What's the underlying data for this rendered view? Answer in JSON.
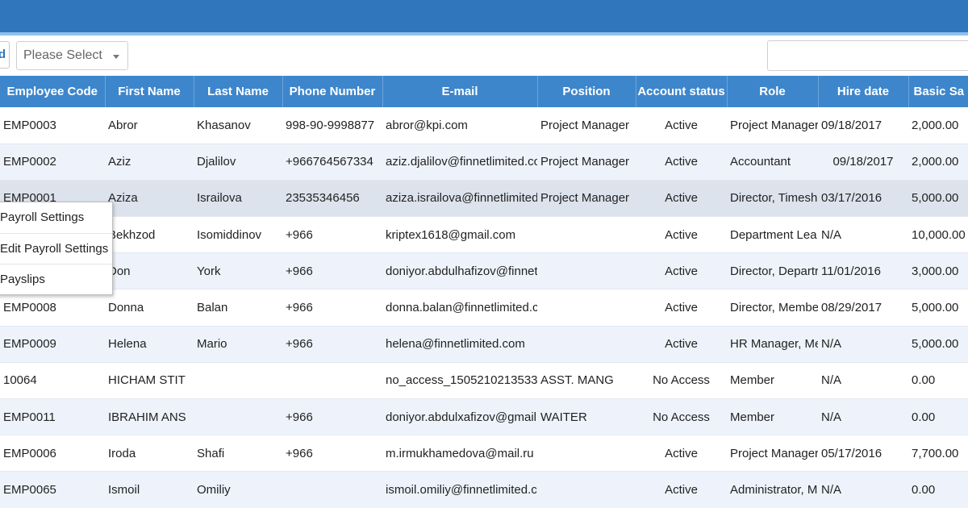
{
  "toolbar": {
    "edge_button_label": "d",
    "select_value": "Please Select",
    "search_placeholder": ""
  },
  "table": {
    "headers": [
      "Employee Code",
      "First Name",
      "Last Name",
      "Phone Number",
      "E-mail",
      "Position",
      "Account status",
      "Role",
      "Hire date",
      "Basic Sa"
    ],
    "rows": [
      [
        "EMP0003",
        "Abror",
        "Khasanov",
        "998-90-9998877",
        "abror@kpi.com",
        "Project Manager",
        "Active",
        "Project Manager",
        "09/18/2017",
        "2,000.00"
      ],
      [
        "EMP0002",
        "Aziz",
        "Djalilov",
        "+966764567334",
        "aziz.djalilov@finnetlimited.co",
        "Project Manager",
        "Active",
        "Accountant",
        "09/18/2017",
        "2,000.00"
      ],
      [
        "EMP0001",
        "Aziza",
        "Israilova",
        "23535346456",
        "aziza.israilova@finnetlimited",
        "Project Manager",
        "Active",
        "Director, Timesh",
        "03/17/2016",
        "5,000.00"
      ],
      [
        "",
        "Bekhzod",
        "Isomiddinov",
        "+966",
        "kriptex1618@gmail.com",
        "",
        "Active",
        "Department Lea",
        "N/A",
        "10,000.00"
      ],
      [
        "",
        "Don",
        "York",
        "+966",
        "doniyor.abdulhafizov@finnet",
        "",
        "Active",
        "Director, Departr",
        "11/01/2016",
        "3,000.00"
      ],
      [
        "EMP0008",
        "Donna",
        "Balan",
        "+966",
        "donna.balan@finnetlimited.c",
        "",
        "Active",
        "Director, Membe",
        "08/29/2017",
        "5,000.00"
      ],
      [
        "EMP0009",
        "Helena",
        "Mario",
        "+966",
        "helena@finnetlimited.com",
        "",
        "Active",
        "HR Manager, Me",
        "N/A",
        "5,000.00"
      ],
      [
        "10064",
        "HICHAM STIT",
        "",
        "",
        "no_access_1505210213533",
        "ASST. MANG",
        "No Access",
        "Member",
        "N/A",
        "0.00"
      ],
      [
        "EMP0011",
        "IBRAHIM ANS",
        "",
        "+966",
        "doniyor.abdulxafizov@gmail",
        "WAITER",
        "No Access",
        "Member",
        "N/A",
        "0.00"
      ],
      [
        "EMP0006",
        "Iroda",
        "Shafi",
        "+966",
        "m.irmukhamedova@mail.ru",
        "",
        "Active",
        "Project Manager",
        "05/17/2016",
        "7,700.00"
      ],
      [
        "EMP0065",
        "Ismoil",
        "Omiliy",
        "",
        "ismoil.omiliy@finnetlimited.c",
        "",
        "Active",
        "Administrator, M",
        "N/A",
        "0.00"
      ]
    ]
  },
  "context_menu": {
    "items": [
      "Payroll Settings",
      "Edit Payroll Settings",
      "Payslips"
    ]
  }
}
